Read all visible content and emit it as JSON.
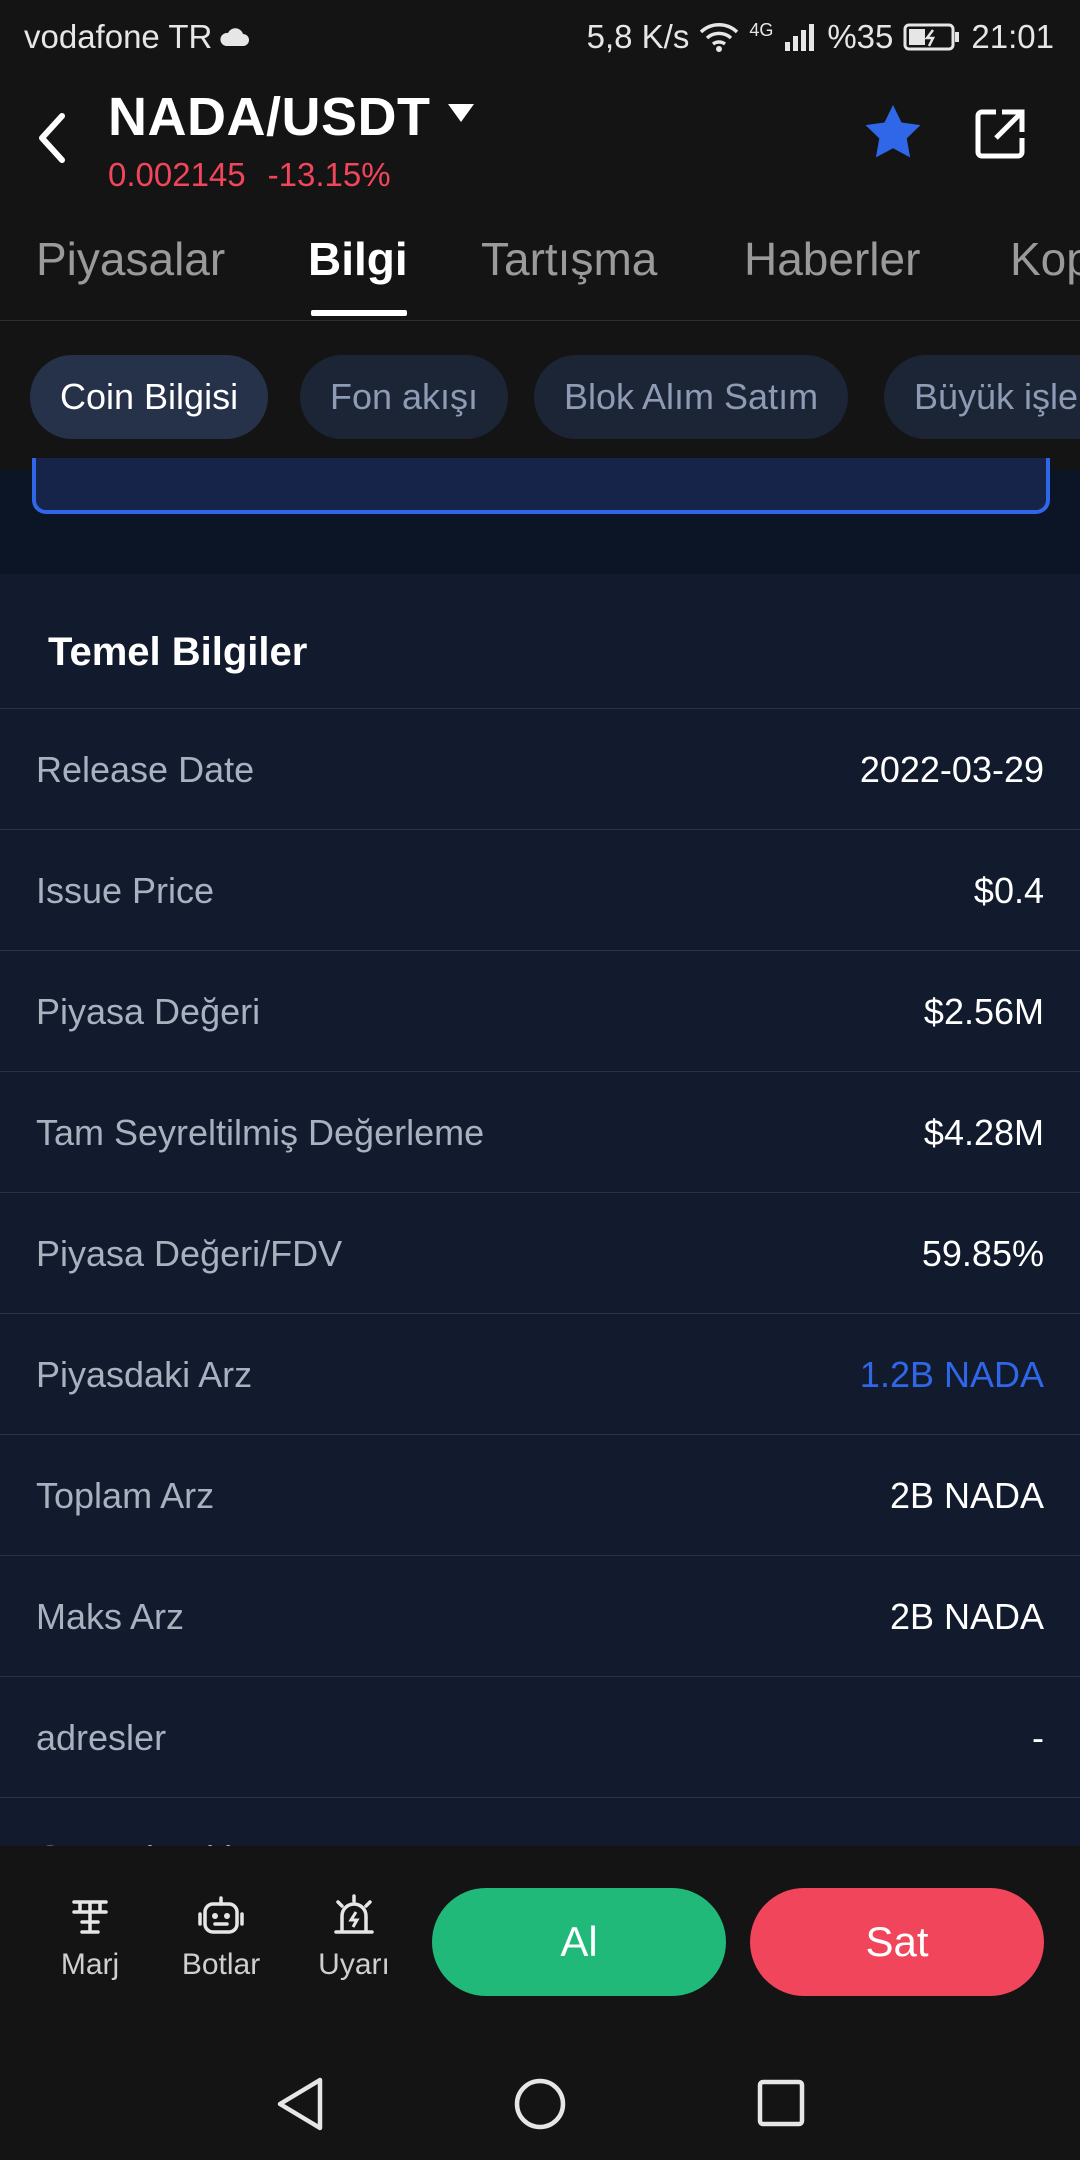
{
  "status_bar": {
    "carrier": "vodafone TR",
    "net_speed": "5,8 K/s",
    "network": "4G",
    "battery": "%35",
    "time": "21:01"
  },
  "header": {
    "pair": "NADA/USDT",
    "price": "0.002145",
    "change": "-13.15%",
    "colors": {
      "negative": "#f0455a",
      "accent": "#2f67e8"
    }
  },
  "tabs": [
    "Piyasalar",
    "Bilgi",
    "Tartışma",
    "Haberler",
    "Kop"
  ],
  "chips": [
    "Coin Bilgisi",
    "Fon akışı",
    "Blok Alım Satım",
    "Büyük işle"
  ],
  "section": {
    "title": "Temel Bilgiler",
    "rows": [
      {
        "label": "Release Date",
        "value": "2022-03-29"
      },
      {
        "label": "Issue Price",
        "value": "$0.4"
      },
      {
        "label": "Piyasa Değeri",
        "value": "$2.56M"
      },
      {
        "label": "Tam Seyreltilmiş Değerleme",
        "value": "$4.28M"
      },
      {
        "label": "Piyasa Değeri/FDV",
        "value": "59.85%"
      },
      {
        "label": "Piyasdaki Arz",
        "value": "1.2B NADA"
      },
      {
        "label": "Toplam Arz",
        "value": "2B NADA"
      },
      {
        "label": "Maks Arz",
        "value": "2B NADA"
      },
      {
        "label": "adresler",
        "value": "-"
      },
      {
        "label": "Core Algorithm",
        "value": ""
      }
    ]
  },
  "action_bar": {
    "items": [
      "Marj",
      "Botlar",
      "Uyarı"
    ],
    "buy": "Al",
    "sell": "Sat",
    "colors": {
      "buy": "#21b979",
      "sell": "#f0455a"
    }
  }
}
